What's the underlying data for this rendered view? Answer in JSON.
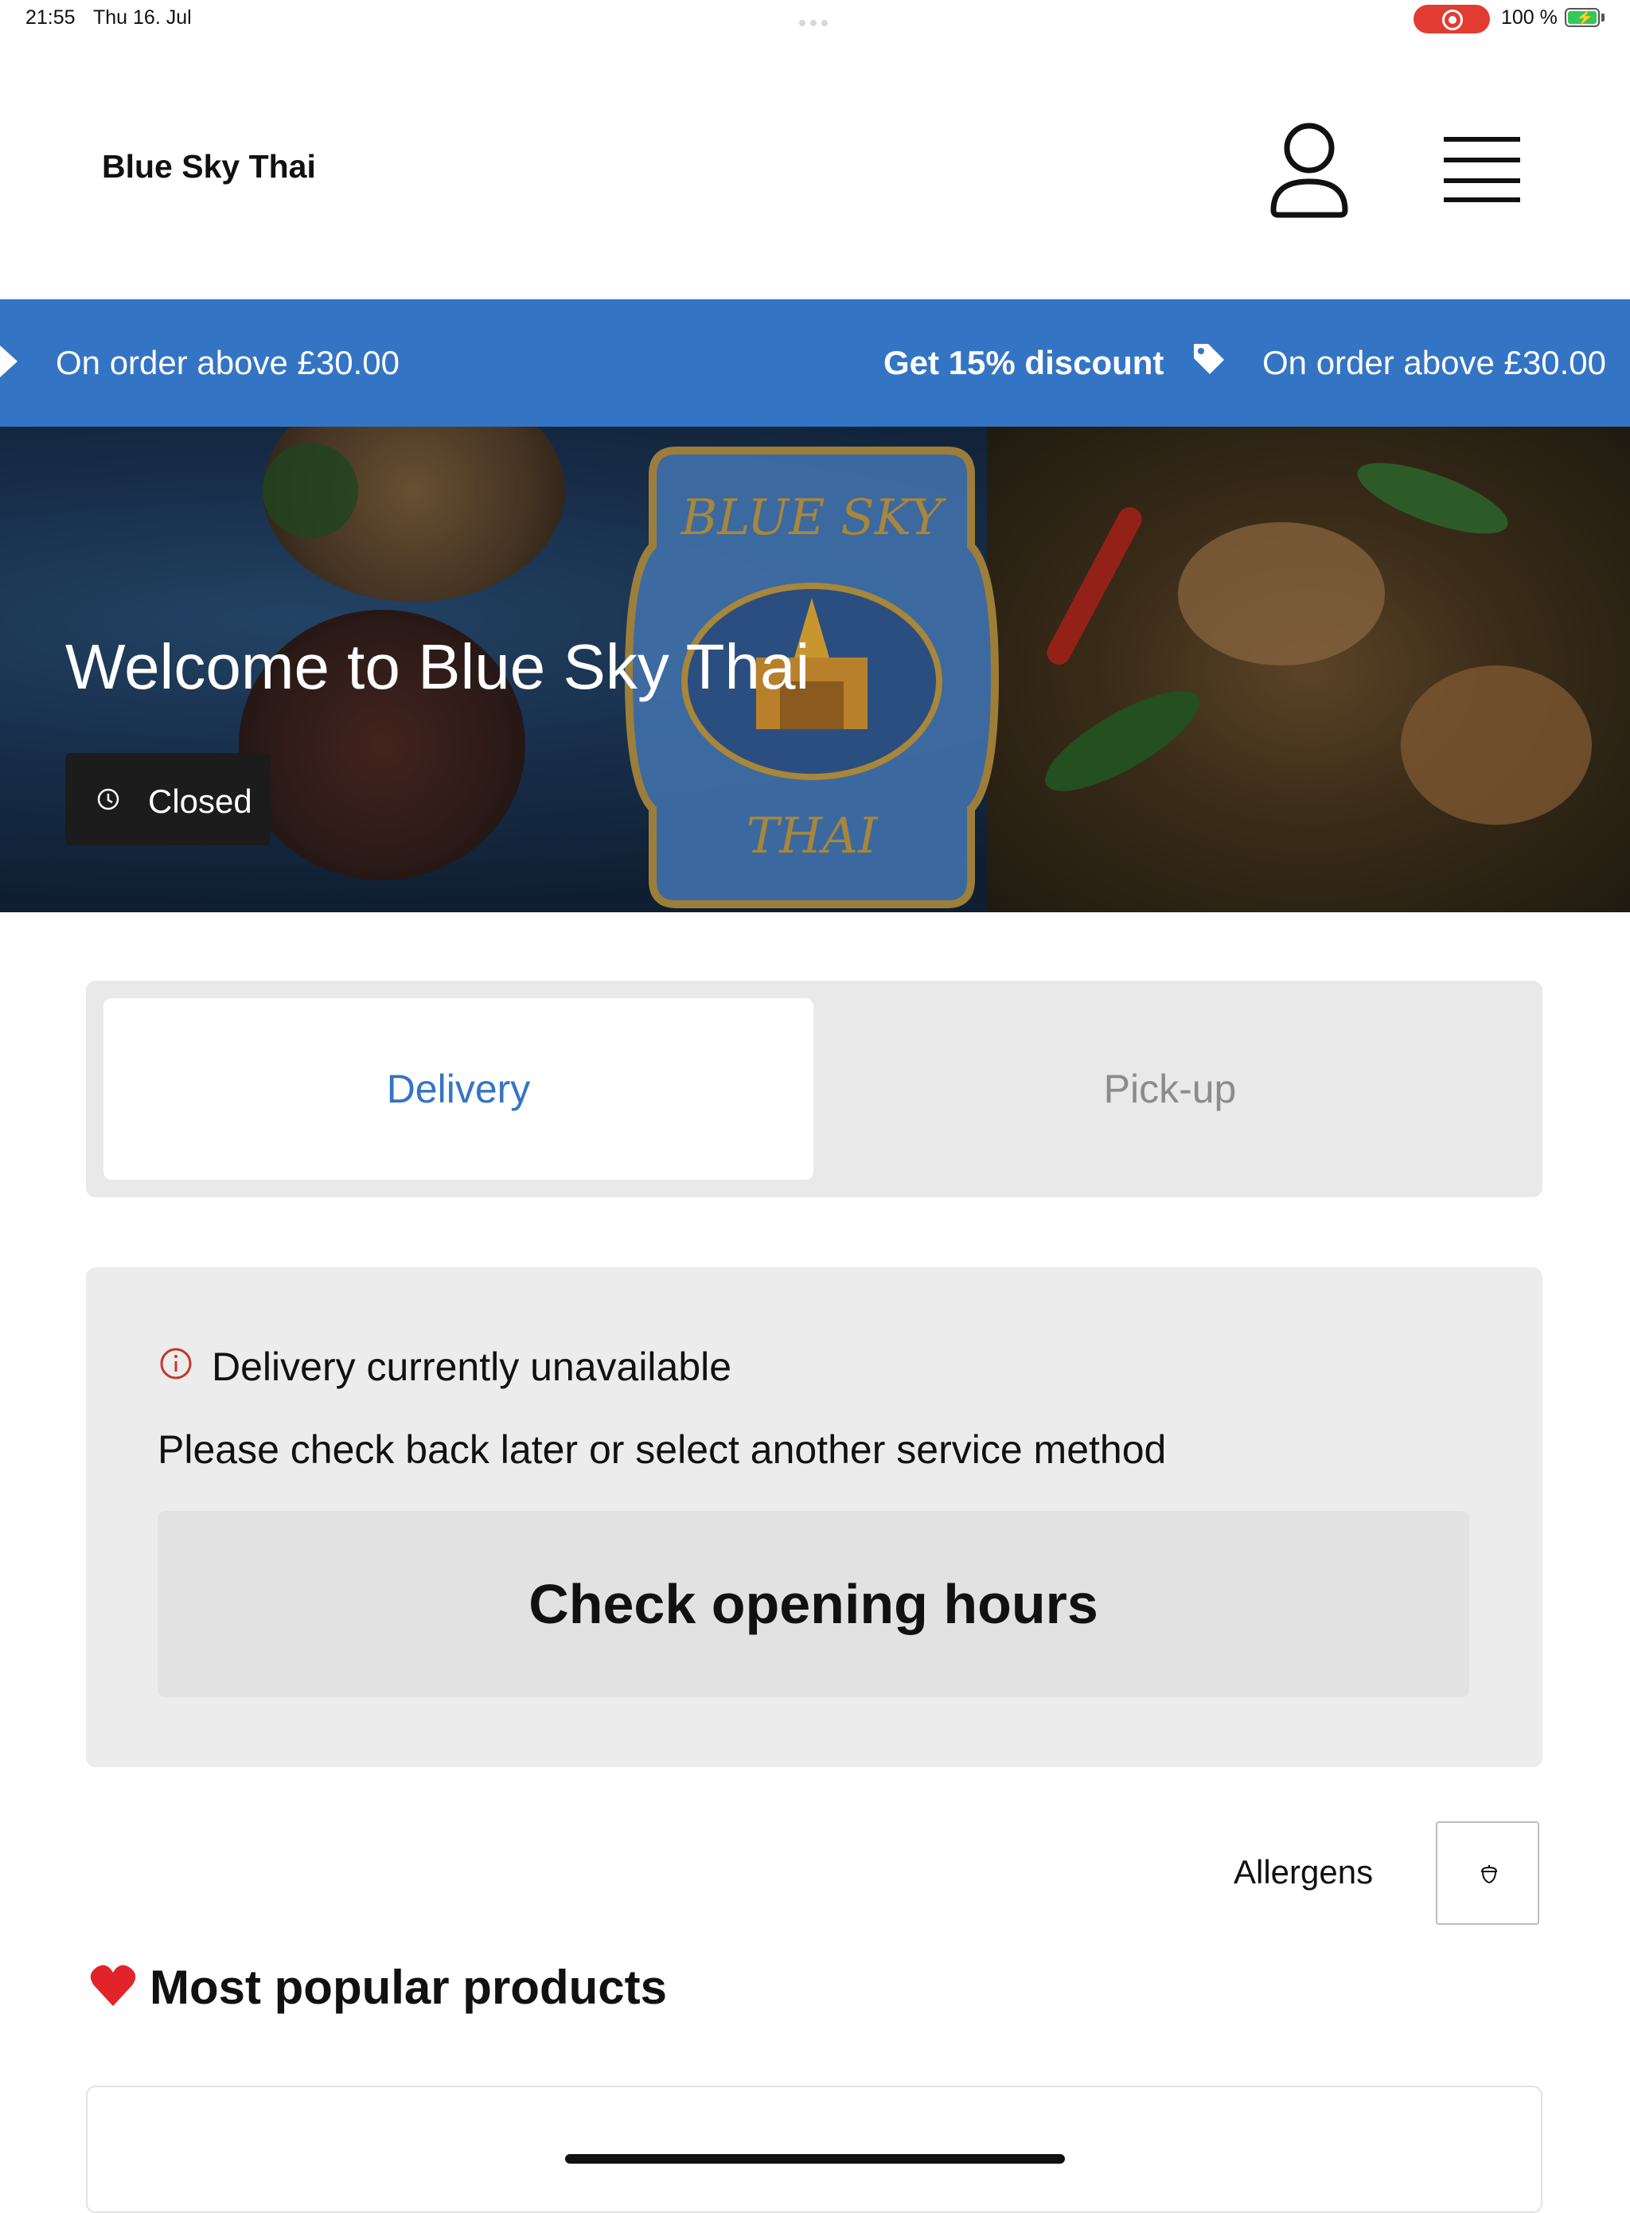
{
  "status_bar": {
    "time": "21:55",
    "date": "Thu 16. Jul",
    "battery": "100 %",
    "recording_color": "#e23b32"
  },
  "header": {
    "brand": "Blue Sky Thai",
    "user_icon": "user-icon",
    "menu_icon": "hamburger-menu-icon"
  },
  "promo": {
    "left_text": "On order above £30.00",
    "bold_text": "Get 15% discount",
    "right_text": "On order above £30.00",
    "background": "#3474c4",
    "tag_icon": "tag-icon"
  },
  "hero": {
    "title": "Welcome to  Blue Sky Thai",
    "status": "Closed",
    "logo_top": "BLUE SKY",
    "logo_bottom": "THAI"
  },
  "service_tabs": {
    "delivery": "Delivery",
    "pickup": "Pick-up",
    "active": "Delivery",
    "accent": "#3474c4"
  },
  "notice": {
    "title": "Delivery currently unavailable",
    "body": "Please check back later or select another service method",
    "button": "Check opening hours",
    "icon": "info-icon",
    "icon_color": "#c0392b"
  },
  "allergens": {
    "label": "Allergens",
    "icon": "acorn-icon"
  },
  "popular": {
    "heading": "Most popular products",
    "icon": "heart-icon"
  }
}
